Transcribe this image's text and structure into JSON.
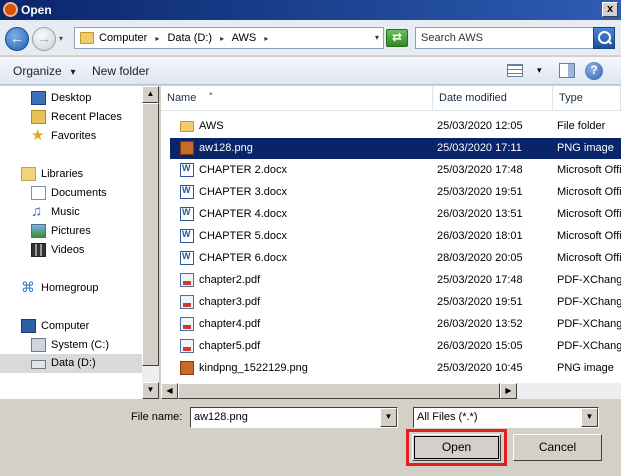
{
  "window": {
    "title": "Open",
    "close_glyph": "x"
  },
  "address_bar": {
    "back_glyph": "←",
    "crumbs": [
      "Computer",
      "Data (D:)",
      "AWS"
    ],
    "separator": "▸",
    "dropdown_glyph": "▾",
    "refresh_glyph": "⇄",
    "search_placeholder": "Search AWS"
  },
  "toolbar": {
    "organize": "Organize",
    "new_folder": "New folder",
    "view_dd": "▾",
    "help": "?"
  },
  "nav_pane": {
    "items": [
      {
        "label": "Desktop",
        "icon": "desktop-icon"
      },
      {
        "label": "Recent Places",
        "icon": "recent-places-icon"
      },
      {
        "label": "Favorites",
        "icon": "star-icon"
      },
      {
        "label": "Libraries",
        "icon": "libraries-icon"
      },
      {
        "label": "Documents",
        "icon": "documents-icon"
      },
      {
        "label": "Music",
        "icon": "music-icon"
      },
      {
        "label": "Pictures",
        "icon": "pictures-icon"
      },
      {
        "label": "Videos",
        "icon": "videos-icon"
      },
      {
        "label": "Homegroup",
        "icon": "homegroup-icon"
      },
      {
        "label": "Computer",
        "icon": "computer-icon"
      },
      {
        "label": "System (C:)",
        "icon": "drive-icon"
      },
      {
        "label": "Data (D:)",
        "icon": "drive-icon",
        "selected": true
      }
    ],
    "star_glyph": "★",
    "music_glyph": "♫",
    "home_glyph": "⌘"
  },
  "file_list": {
    "columns": {
      "name": "Name",
      "date": "Date modified",
      "type": "Type",
      "sort_glyph": "▴"
    },
    "rows": [
      {
        "name": "AWS",
        "date": "25/03/2020 12:05",
        "type": "File folder",
        "kind": "folder"
      },
      {
        "name": "aw128.png",
        "date": "25/03/2020 17:11",
        "type": "PNG image",
        "kind": "png",
        "selected": true
      },
      {
        "name": "CHAPTER 2.docx",
        "date": "25/03/2020 17:48",
        "type": "Microsoft Office",
        "kind": "docx"
      },
      {
        "name": "CHAPTER 3.docx",
        "date": "25/03/2020 19:51",
        "type": "Microsoft Office",
        "kind": "docx"
      },
      {
        "name": "CHAPTER 4.docx",
        "date": "26/03/2020 13:51",
        "type": "Microsoft Office",
        "kind": "docx"
      },
      {
        "name": "CHAPTER 5.docx",
        "date": "26/03/2020 18:01",
        "type": "Microsoft Office",
        "kind": "docx"
      },
      {
        "name": "CHAPTER 6.docx",
        "date": "28/03/2020 20:05",
        "type": "Microsoft Office",
        "kind": "docx"
      },
      {
        "name": "chapter2.pdf",
        "date": "25/03/2020 17:48",
        "type": "PDF-XChange",
        "kind": "pdf"
      },
      {
        "name": "chapter3.pdf",
        "date": "25/03/2020 19:51",
        "type": "PDF-XChange",
        "kind": "pdf"
      },
      {
        "name": "chapter4.pdf",
        "date": "26/03/2020 13:52",
        "type": "PDF-XChange",
        "kind": "pdf"
      },
      {
        "name": "chapter5.pdf",
        "date": "26/03/2020 15:05",
        "type": "PDF-XChange",
        "kind": "pdf"
      },
      {
        "name": "kindpng_1522129.png",
        "date": "25/03/2020 10:45",
        "type": "PNG image",
        "kind": "png"
      }
    ]
  },
  "scroll": {
    "up": "▲",
    "down": "▼",
    "left": "◀",
    "right": "▶"
  },
  "footer": {
    "file_name_label": "File name:",
    "file_name_value": "aw128.png",
    "file_type_value": "All Files (*.*)",
    "dropdown_glyph": "▼",
    "open_label": "Open",
    "cancel_label": "Cancel"
  },
  "colors": {
    "selection": "#0a246a",
    "highlight_box": "#e0201d"
  }
}
